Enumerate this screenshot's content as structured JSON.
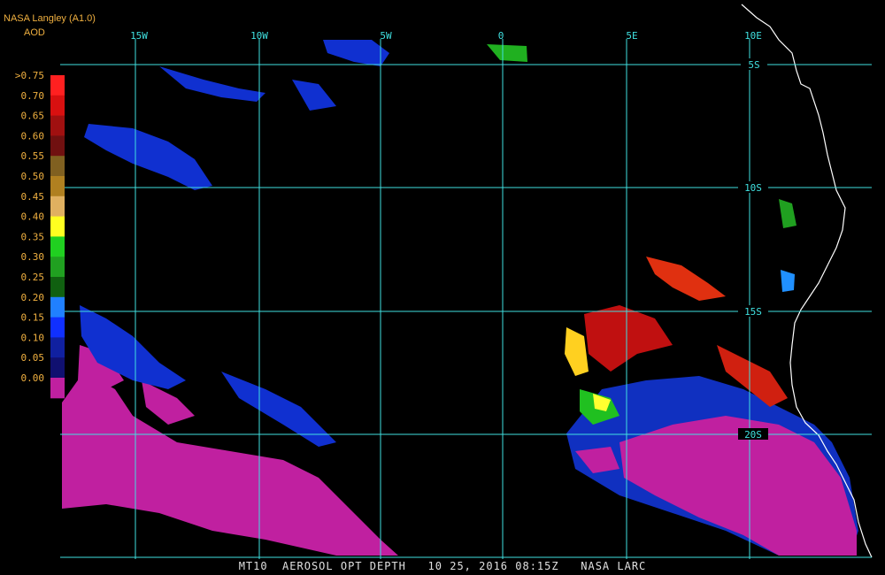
{
  "header": {
    "title": "NASA Langley (A1.0)",
    "product": "AOD"
  },
  "caption": "MT10  AEROSOL OPT DEPTH   10 25, 2016 08:15Z   NASA LARC",
  "grid": {
    "lon_labels": [
      "15W",
      "10W",
      "5W",
      "0",
      "5E",
      "10E"
    ],
    "lat_labels": [
      "5S",
      "10S",
      "15S",
      "20S"
    ]
  },
  "color_scale": {
    "labels": [
      ">0.75",
      "0.70",
      "0.65",
      "0.60",
      "0.55",
      "0.50",
      "0.45",
      "0.40",
      "0.35",
      "0.30",
      "0.25",
      "0.20",
      "0.15",
      "0.10",
      "0.05",
      "0.00"
    ],
    "colors": [
      "#ff2020",
      "#d81010",
      "#a01010",
      "#701010",
      "#806020",
      "#b08020",
      "#e0b060",
      "#ffff20",
      "#20d020",
      "#20a020",
      "#106010",
      "#2080ff",
      "#1030ff",
      "#1020a0",
      "#101070",
      "#c020a0"
    ]
  },
  "colors": {
    "grid": "#40e0e0",
    "label": "#f0b040",
    "coast": "#ffffff"
  }
}
